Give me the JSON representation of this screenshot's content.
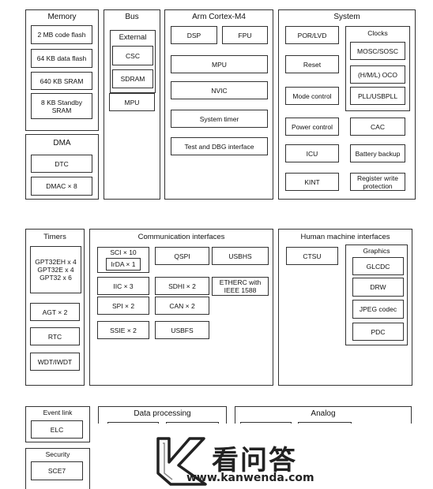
{
  "memory": {
    "title": "Memory",
    "items": [
      "2 MB code flash",
      "64 KB data flash",
      "640 KB SRAM",
      "8 KB Standby SRAM"
    ]
  },
  "dma": {
    "title": "DMA",
    "items": [
      "DTC",
      "DMAC × 8"
    ]
  },
  "bus": {
    "title": "Bus",
    "external": {
      "title": "External",
      "items": [
        "CSC",
        "SDRAM"
      ]
    },
    "mpu": "MPU"
  },
  "cpu": {
    "title": "Arm Cortex-M4",
    "items": [
      "DSP",
      "FPU",
      "MPU",
      "NVIC",
      "System timer",
      "Test and DBG interface"
    ]
  },
  "system": {
    "title": "System",
    "left": [
      "POR/LVD",
      "Reset",
      "Mode control",
      "Power control",
      "ICU",
      "KINT"
    ],
    "clocks": {
      "title": "Clocks",
      "items": [
        "MOSC/SOSC",
        "(H/M/L) OCO",
        "PLL/USBPLL"
      ]
    },
    "right": [
      "CAC",
      "Battery backup",
      "Register write protection"
    ]
  },
  "timers": {
    "title": "Timers",
    "gpt": [
      "GPT32EH x 4",
      "GPT32E x 4",
      "GPT32 x 6"
    ],
    "items": [
      "AGT × 2",
      "RTC",
      "WDT/IWDT"
    ]
  },
  "comm": {
    "title": "Communication interfaces",
    "sci": "SCI × 10",
    "irda": "IrDA × 1",
    "items": [
      "QSPI",
      "USBHS",
      "IIC × 3",
      "SDHI × 2",
      "ETHERC with IEEE 1588",
      "SPI × 2",
      "CAN × 2",
      "SSIE × 2",
      "USBFS"
    ]
  },
  "hmi": {
    "title": "Human machine interfaces",
    "ctsu": "CTSU",
    "graphics": {
      "title": "Graphics",
      "items": [
        "GLCDC",
        "DRW",
        "JPEG codec",
        "PDC"
      ]
    }
  },
  "eventlink": {
    "title": "Event link",
    "item": "ELC"
  },
  "security": {
    "title": "Security",
    "item": "SCE7"
  },
  "dataproc": {
    "title": "Data processing"
  },
  "analog": {
    "title": "Analog"
  },
  "watermark": {
    "brand": "看问答",
    "url": "www.kanwenda.com"
  }
}
